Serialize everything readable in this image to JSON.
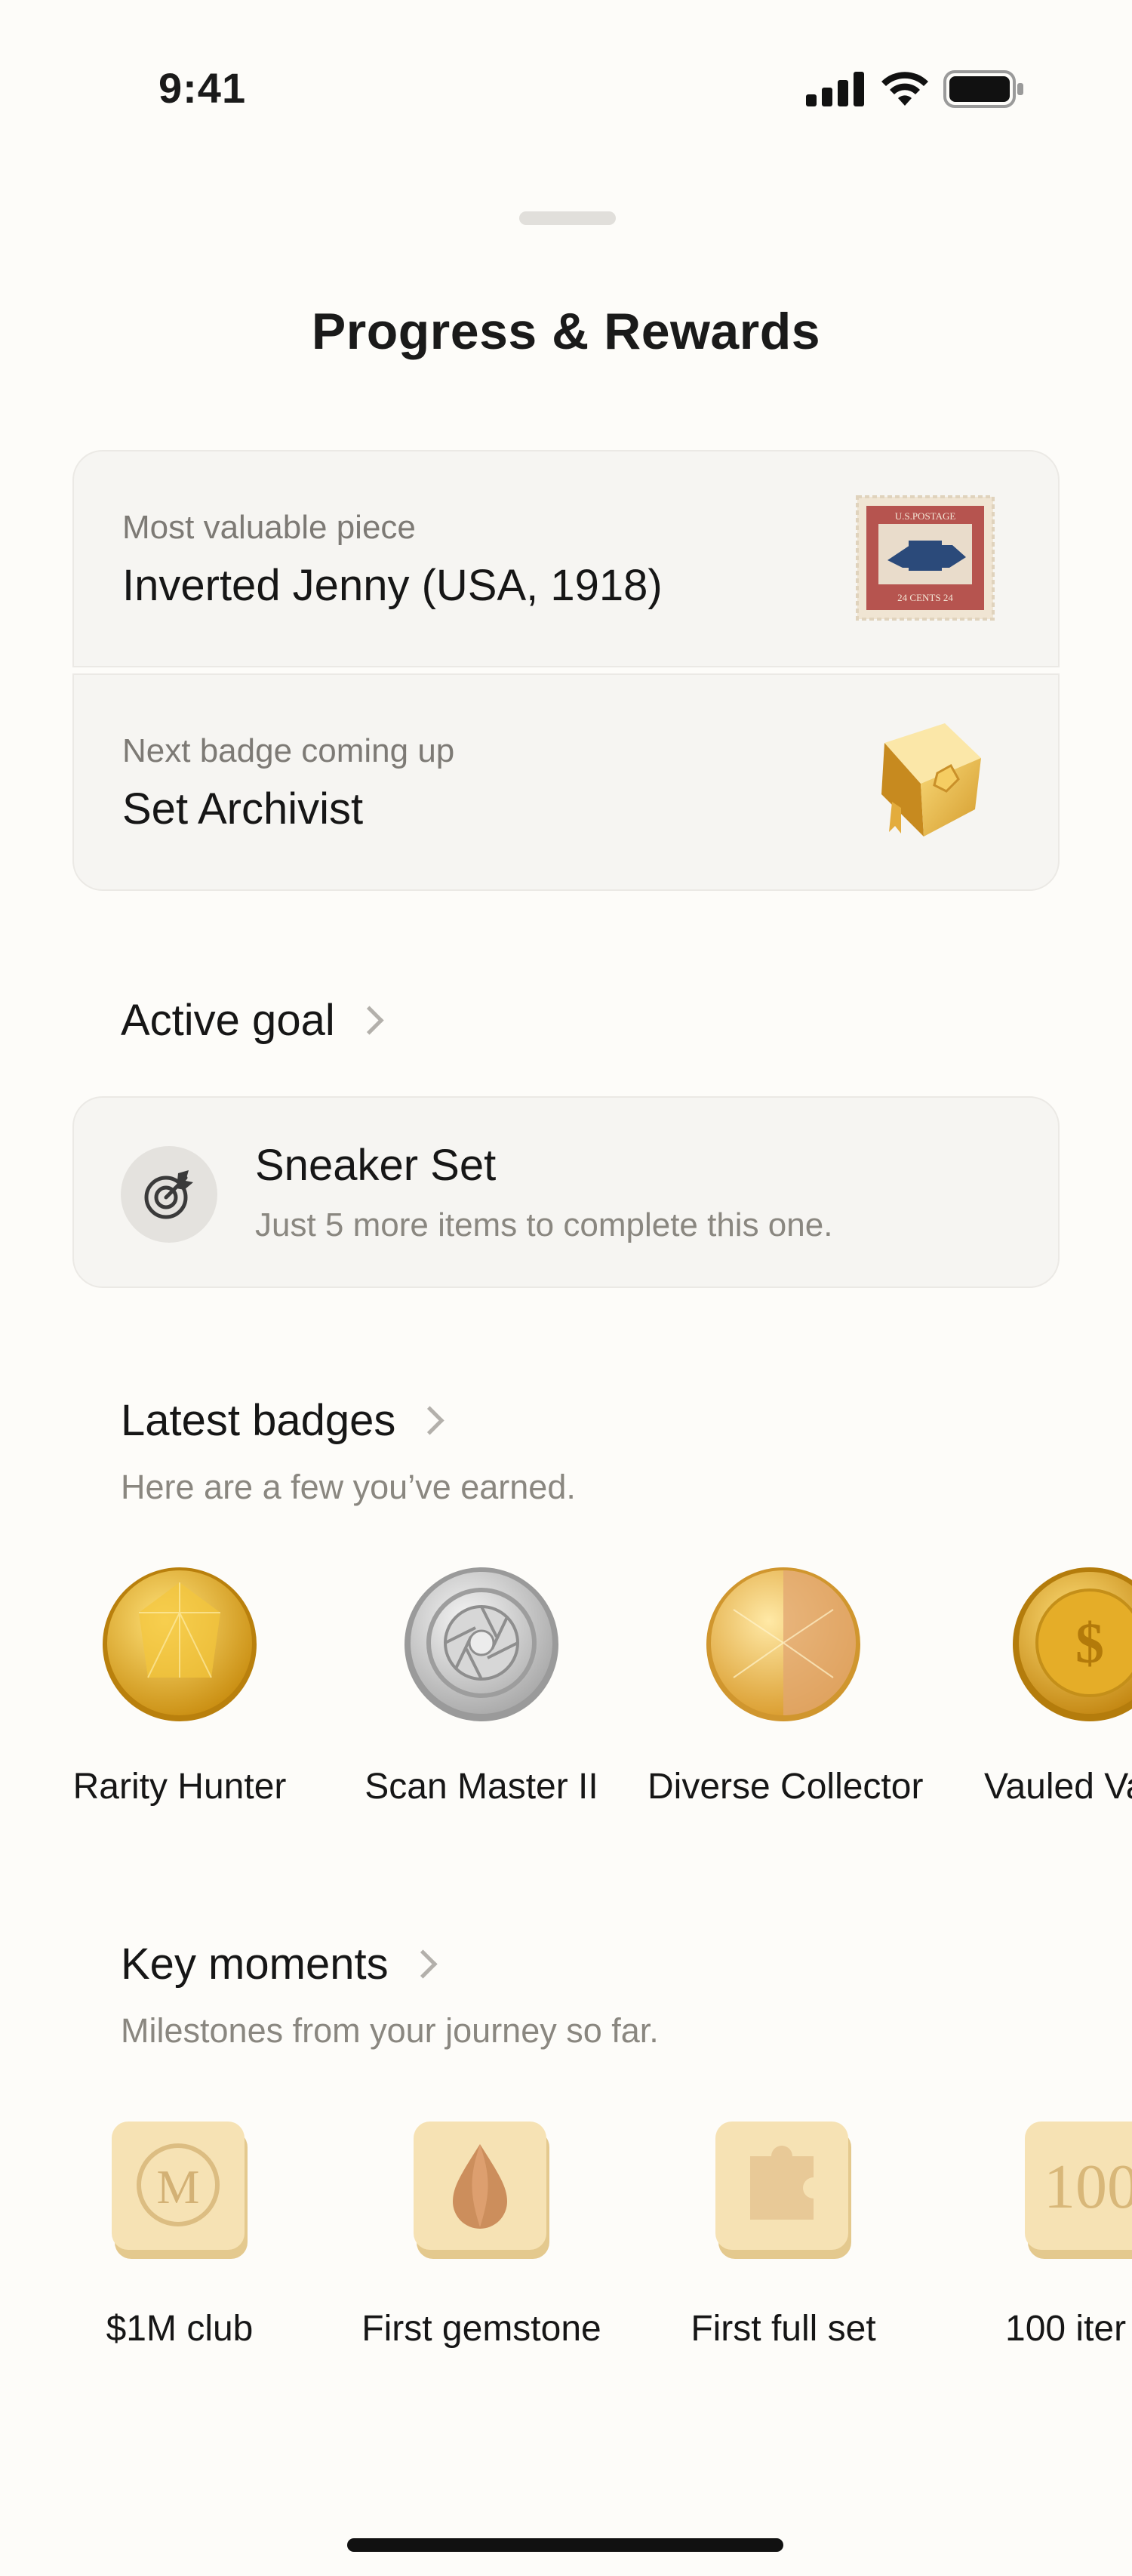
{
  "status_bar": {
    "time": "9:41"
  },
  "title": "Progress & Rewards",
  "summary": [
    {
      "label": "Most valuable piece",
      "value": "Inverted Jenny (USA, 1918)",
      "icon": "stamp-icon"
    },
    {
      "label": "Next badge coming up",
      "value": "Set Archivist",
      "icon": "gold-book-badge-icon"
    }
  ],
  "active_goal": {
    "title": "Active goal",
    "goal_name": "Sneaker Set",
    "goal_description": "Just 5 more items to complete this one."
  },
  "latest_badges": {
    "title": "Latest badges",
    "subtitle": "Here are a few you’ve earned.",
    "items": [
      {
        "label": "Rarity Hunter",
        "icon": "gold-gem-badge-icon"
      },
      {
        "label": "Scan Master II",
        "icon": "silver-aperture-badge-icon"
      },
      {
        "label": "Diverse Collector",
        "icon": "gold-prism-badge-icon"
      },
      {
        "label": "Vauled Va",
        "icon": "gold-dollar-coin-icon"
      }
    ]
  },
  "key_moments": {
    "title": "Key moments",
    "subtitle": "Milestones from your journey so far.",
    "items": [
      {
        "label": "$1M club",
        "icon": "m-coin-tile-icon"
      },
      {
        "label": "First gemstone",
        "icon": "drop-tile-icon"
      },
      {
        "label": "First full set",
        "icon": "puzzle-tile-icon"
      },
      {
        "label": "100 iter",
        "icon": "hundred-tile-icon",
        "tile_text": "100"
      }
    ]
  }
}
